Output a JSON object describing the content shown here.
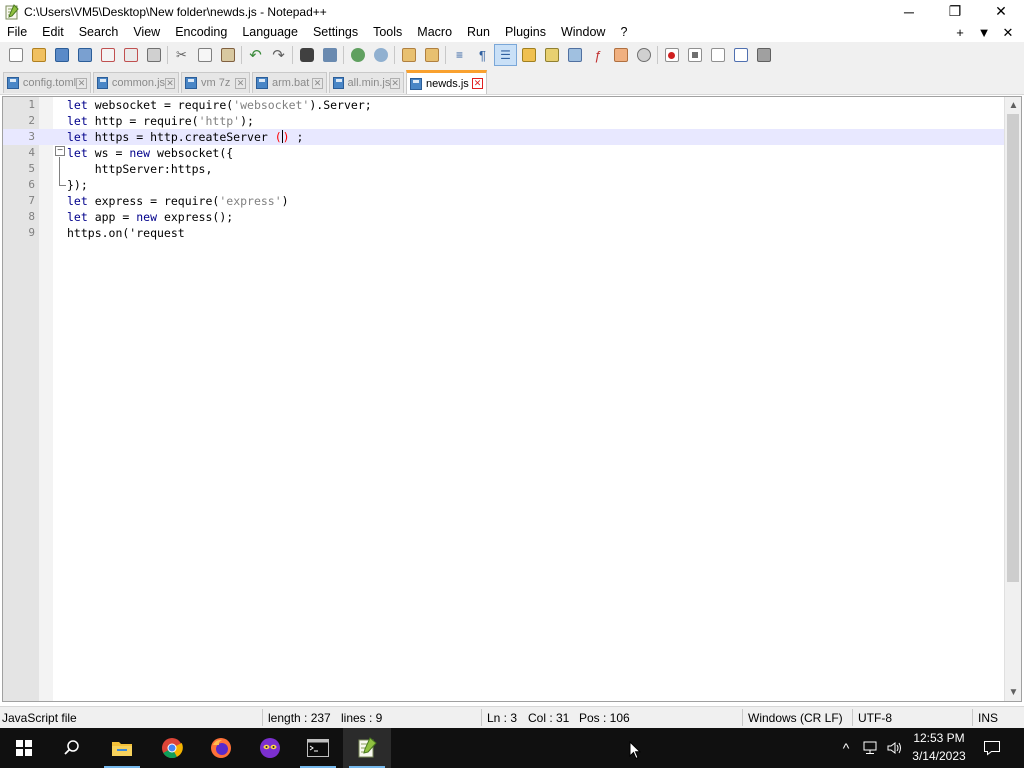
{
  "window": {
    "title": "C:\\Users\\VM5\\Desktop\\New folder\\newds.js - Notepad++",
    "minimize_glyph": "─",
    "restore_glyph": "❐",
    "close_glyph": "✕"
  },
  "menu": {
    "items": [
      "File",
      "Edit",
      "Search",
      "View",
      "Encoding",
      "Language",
      "Settings",
      "Tools",
      "Macro",
      "Run",
      "Plugins",
      "Window",
      "?"
    ],
    "right": [
      "+",
      "▼",
      "✕"
    ]
  },
  "tabs": [
    {
      "label": "config.toml",
      "active": false
    },
    {
      "label": "common.js",
      "active": false
    },
    {
      "label": "vm 7z",
      "active": false
    },
    {
      "label": "arm.bat",
      "active": false
    },
    {
      "label": "all.min.js",
      "active": false
    },
    {
      "label": "newds.js",
      "active": true
    }
  ],
  "editor": {
    "current_line": 3,
    "lines": [
      {
        "n": "1",
        "tokens": [
          [
            "kw",
            "let"
          ],
          [
            "tk",
            " websocket = require("
          ],
          [
            "str",
            "'websocket'"
          ],
          [
            "tk",
            ").Server;"
          ]
        ]
      },
      {
        "n": "2",
        "tokens": [
          [
            "kw",
            "let"
          ],
          [
            "tk",
            " http = require("
          ],
          [
            "str",
            "'http'"
          ],
          [
            "tk",
            ");"
          ]
        ]
      },
      {
        "n": "3",
        "tokens": [
          [
            "kw",
            "let"
          ],
          [
            "tk",
            " https = http.createServer "
          ],
          [
            "hl",
            "("
          ],
          [
            "caret",
            ""
          ],
          [
            "hl",
            ")"
          ],
          [
            "tk",
            " ;"
          ]
        ]
      },
      {
        "n": "4",
        "tokens": [
          [
            "kw",
            "let"
          ],
          [
            "tk",
            " ws = "
          ],
          [
            "kw",
            "new"
          ],
          [
            "tk",
            " websocket({"
          ]
        ]
      },
      {
        "n": "5",
        "tokens": [
          [
            "tk",
            "    httpServer:https,"
          ]
        ]
      },
      {
        "n": "6",
        "tokens": [
          [
            "tk",
            "});"
          ]
        ]
      },
      {
        "n": "7",
        "tokens": [
          [
            "kw",
            "let"
          ],
          [
            "tk",
            " express = require("
          ],
          [
            "str",
            "'express'"
          ],
          [
            "tk",
            ")"
          ]
        ]
      },
      {
        "n": "8",
        "tokens": [
          [
            "kw",
            "let"
          ],
          [
            "tk",
            " app = "
          ],
          [
            "kw",
            "new"
          ],
          [
            "tk",
            " express();"
          ]
        ]
      },
      {
        "n": "9",
        "tokens": [
          [
            "tk",
            "https.on('request"
          ]
        ]
      }
    ]
  },
  "status": {
    "file_type": "JavaScript file",
    "length": "length : 237",
    "lines": "lines : 9",
    "ln": "Ln : 3",
    "col": "Col : 31",
    "pos": "Pos : 106",
    "eol": "Windows (CR LF)",
    "encoding": "UTF-8",
    "mode": "INS"
  },
  "taskbar": {
    "time": "12:53 PM",
    "date": "3/14/2023",
    "tray_chevron": "^"
  },
  "colors": {
    "keyword": "#00008b",
    "string": "#808080",
    "current_line": "#e8e8ff",
    "active_tab_accent": "#f9a12f",
    "taskbar": "#101010"
  }
}
